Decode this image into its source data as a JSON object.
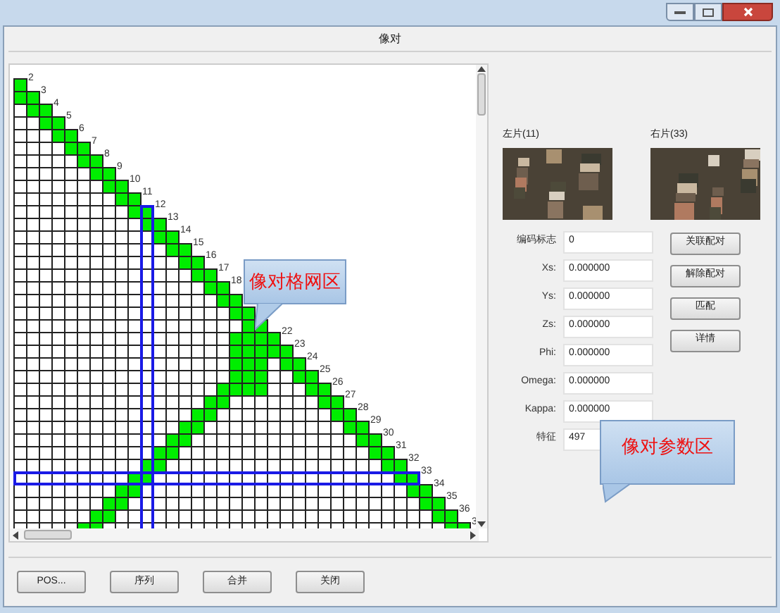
{
  "window": {
    "title": "像对"
  },
  "grid": {
    "rows": [
      {
        "label": "2",
        "selected": false,
        "column_selected": false
      },
      {
        "label": "3",
        "selected": false,
        "column_selected": false
      },
      {
        "label": "4",
        "selected": false,
        "column_selected": false
      },
      {
        "label": "5",
        "selected": false,
        "column_selected": false
      },
      {
        "label": "6",
        "selected": false,
        "column_selected": false
      },
      {
        "label": "7",
        "selected": false,
        "column_selected": false
      },
      {
        "label": "8",
        "selected": false,
        "column_selected": false
      },
      {
        "label": "9",
        "selected": false,
        "column_selected": false
      },
      {
        "label": "10",
        "selected": false,
        "column_selected": false
      },
      {
        "label": "11",
        "selected": false,
        "column_selected": false
      },
      {
        "label": "12",
        "selected": false,
        "column_selected": true
      },
      {
        "label": "13",
        "selected": false,
        "column_selected": false
      },
      {
        "label": "14",
        "selected": false,
        "column_selected": false
      },
      {
        "label": "15",
        "selected": false,
        "column_selected": false
      },
      {
        "label": "16",
        "selected": false,
        "column_selected": false
      },
      {
        "label": "17",
        "selected": false,
        "column_selected": false
      },
      {
        "label": "18",
        "selected": false,
        "column_selected": false
      },
      {
        "selected": false,
        "column_selected": false
      },
      {
        "selected": false,
        "column_selected": false
      },
      {
        "selected": false,
        "column_selected": false
      },
      {
        "label": "22",
        "selected": false,
        "column_selected": false
      },
      {
        "label": "23",
        "selected": false,
        "column_selected": false
      },
      {
        "label": "24",
        "selected": false,
        "column_selected": false
      },
      {
        "label": "25",
        "selected": false,
        "column_selected": false
      },
      {
        "label": "26",
        "selected": false,
        "column_selected": false
      },
      {
        "label": "27",
        "selected": false,
        "column_selected": false
      },
      {
        "label": "28",
        "selected": false,
        "column_selected": false
      },
      {
        "label": "29",
        "selected": false,
        "column_selected": false
      },
      {
        "label": "30",
        "selected": false,
        "column_selected": false
      },
      {
        "label": "31",
        "selected": false,
        "column_selected": false
      },
      {
        "label": "32",
        "selected": false,
        "column_selected": false
      },
      {
        "label": "33",
        "selected": true,
        "column_selected": false
      },
      {
        "label": "34",
        "selected": false,
        "column_selected": false
      },
      {
        "label": "35",
        "selected": false,
        "column_selected": false
      },
      {
        "label": "36",
        "selected": false,
        "column_selected": false
      },
      {
        "label": "3",
        "selected": false,
        "column_selected": false
      }
    ]
  },
  "left_image": {
    "label": "左片(11)"
  },
  "right_image": {
    "label": "右片(33)"
  },
  "fields": [
    {
      "label": "编码标志",
      "value": "0"
    },
    {
      "label": "Xs:",
      "value": "0.000000"
    },
    {
      "label": "Ys:",
      "value": "0.000000"
    },
    {
      "label": "Zs:",
      "value": "0.000000"
    },
    {
      "label": "Phi:",
      "value": "0.000000"
    },
    {
      "label": "Omega:",
      "value": "0.000000"
    },
    {
      "label": "Kappa:",
      "value": "0.000000"
    },
    {
      "label": "特征",
      "value": "497"
    }
  ],
  "actions": [
    "关联配对",
    "解除配对",
    "匹配",
    "详情"
  ],
  "callouts": [
    {
      "text": "像对格网区"
    },
    {
      "text": "像对参数区"
    }
  ],
  "buttons": [
    "POS...",
    "序列",
    "合并",
    "关闭"
  ]
}
